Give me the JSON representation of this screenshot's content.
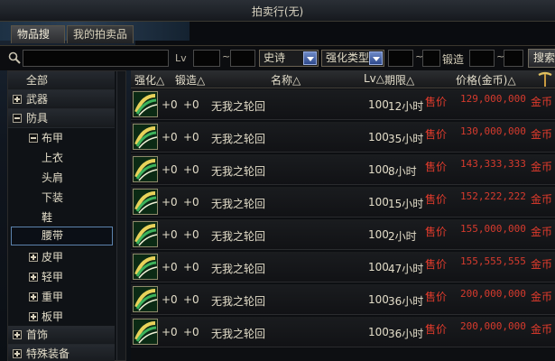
{
  "window": {
    "title": "拍卖行(无)"
  },
  "tabs": [
    {
      "label": "物品搜索",
      "active": true
    },
    {
      "label": "我的拍卖品",
      "active": false
    }
  ],
  "search": {
    "keyword": "",
    "lv_label": "Lv",
    "lv_min": "",
    "lv_max": "",
    "tilde": "~",
    "rarity": "史诗",
    "enhance_type": "强化类型",
    "enhance_min": "",
    "enhance_max": "",
    "forge_label": "锻造",
    "forge_min": "",
    "button": "搜索"
  },
  "categories": [
    {
      "label": "全部",
      "level": 0,
      "toggle": "none"
    },
    {
      "label": "武器",
      "level": 0,
      "toggle": "plus"
    },
    {
      "label": "防具",
      "level": 0,
      "toggle": "minus"
    },
    {
      "label": "布甲",
      "level": 1,
      "toggle": "minus"
    },
    {
      "label": "上衣",
      "level": 2,
      "toggle": "none"
    },
    {
      "label": "头肩",
      "level": 2,
      "toggle": "none"
    },
    {
      "label": "下装",
      "level": 2,
      "toggle": "none"
    },
    {
      "label": "鞋",
      "level": 2,
      "toggle": "none"
    },
    {
      "label": "腰带",
      "level": 2,
      "toggle": "none",
      "selected": true
    },
    {
      "label": "皮甲",
      "level": 1,
      "toggle": "plus"
    },
    {
      "label": "轻甲",
      "level": 1,
      "toggle": "plus"
    },
    {
      "label": "重甲",
      "level": 1,
      "toggle": "plus"
    },
    {
      "label": "板甲",
      "level": 1,
      "toggle": "plus"
    },
    {
      "label": "首饰",
      "level": 0,
      "toggle": "plus"
    },
    {
      "label": "特殊装备",
      "level": 0,
      "toggle": "plus"
    }
  ],
  "columns": {
    "enhance": "强化△",
    "forge": "锻造△",
    "name": "名称△",
    "lv": "Lv△",
    "time": "期限△",
    "price": "价格(金币)△"
  },
  "rows": [
    {
      "enhance": "+0",
      "forge": "+0",
      "name": "无我之轮回",
      "lv": "100",
      "time": "12小时",
      "sale_label": "售价",
      "price": "129,000,000",
      "currency": "金币"
    },
    {
      "enhance": "+0",
      "forge": "+0",
      "name": "无我之轮回",
      "lv": "100",
      "time": "35小时",
      "sale_label": "售价",
      "price": "130,000,000",
      "currency": "金币"
    },
    {
      "enhance": "+0",
      "forge": "+0",
      "name": "无我之轮回",
      "lv": "100",
      "time": "8小时",
      "sale_label": "售价",
      "price": "143,333,333",
      "currency": "金币"
    },
    {
      "enhance": "+0",
      "forge": "+0",
      "name": "无我之轮回",
      "lv": "100",
      "time": "15小时",
      "sale_label": "售价",
      "price": "152,222,222",
      "currency": "金币"
    },
    {
      "enhance": "+0",
      "forge": "+0",
      "name": "无我之轮回",
      "lv": "100",
      "time": "2小时",
      "sale_label": "售价",
      "price": "155,000,000",
      "currency": "金币"
    },
    {
      "enhance": "+0",
      "forge": "+0",
      "name": "无我之轮回",
      "lv": "100",
      "time": "47小时",
      "sale_label": "售价",
      "price": "155,555,555",
      "currency": "金币"
    },
    {
      "enhance": "+0",
      "forge": "+0",
      "name": "无我之轮回",
      "lv": "100",
      "time": "36小时",
      "sale_label": "售价",
      "price": "200,000,000",
      "currency": "金币"
    },
    {
      "enhance": "+0",
      "forge": "+0",
      "name": "无我之轮回",
      "lv": "100",
      "time": "36小时",
      "sale_label": "售价",
      "price": "200,000,000",
      "currency": "金币"
    }
  ],
  "icons": {
    "search": "magnifier-icon",
    "item": "belt-item-icon",
    "forge_header": "pickaxe-icon",
    "dropdown": "chevron-down-icon"
  },
  "colors": {
    "price": "#d63a2d",
    "sale_label": "#e23b2c",
    "selected_border": "#5c83ad"
  }
}
